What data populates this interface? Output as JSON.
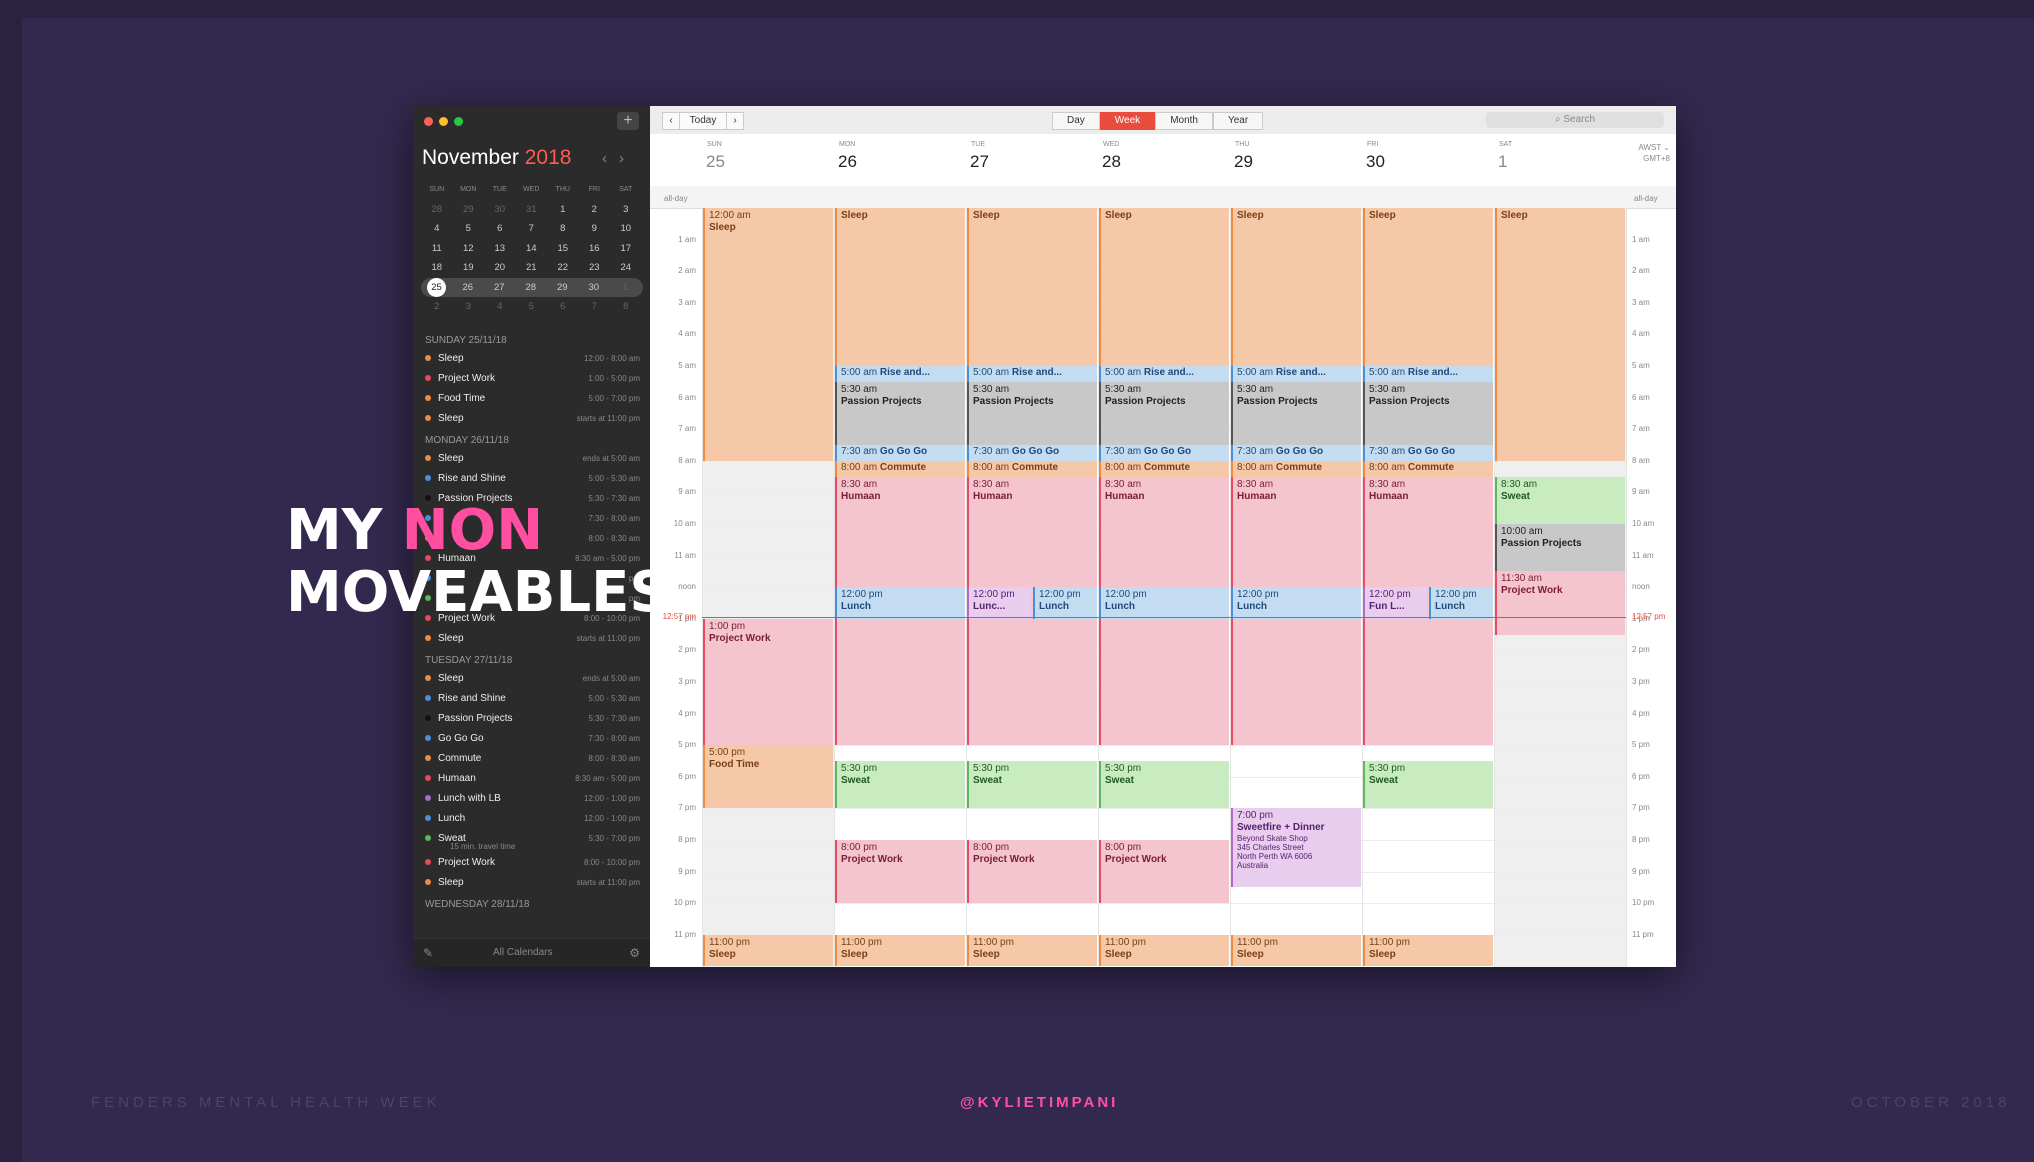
{
  "overlay": {
    "line1a": "MY ",
    "line1b": "NON",
    "line2": "MOVEABLES"
  },
  "footer": {
    "left": "FENDERS MENTAL HEALTH WEEK",
    "center": "@KYLIETIMPANI",
    "right": "OCTOBER 2018"
  },
  "colors": {
    "background": "#33294f",
    "accent_pink": "#ff4fa0",
    "calendar_red": "#e74c3c"
  },
  "sidebar": {
    "month": "November",
    "year": "2018",
    "weekdays": [
      "SUN",
      "MON",
      "TUE",
      "WED",
      "THU",
      "FRI",
      "SAT"
    ],
    "weeks": [
      [
        "28",
        "29",
        "30",
        "31",
        "1",
        "2",
        "3"
      ],
      [
        "4",
        "5",
        "6",
        "7",
        "8",
        "9",
        "10"
      ],
      [
        "11",
        "12",
        "13",
        "14",
        "15",
        "16",
        "17"
      ],
      [
        "18",
        "19",
        "20",
        "21",
        "22",
        "23",
        "24"
      ],
      [
        "25",
        "26",
        "27",
        "28",
        "29",
        "30",
        "1"
      ],
      [
        "2",
        "3",
        "4",
        "5",
        "6",
        "7",
        "8"
      ]
    ],
    "agenda": [
      {
        "header": "SUNDAY 25/11/18",
        "events": [
          {
            "title": "Sleep",
            "time": "12:00 - 8:00 am",
            "color": "#f08a40"
          },
          {
            "title": "Project Work",
            "time": "1:00 - 5:00 pm",
            "color": "#e84a5f"
          },
          {
            "title": "Food Time",
            "time": "5:00 - 7:00 pm",
            "color": "#f08a40"
          },
          {
            "title": "Sleep",
            "time": "starts at 11:00 pm",
            "color": "#f08a40"
          }
        ]
      },
      {
        "header": "MONDAY 26/11/18",
        "events": [
          {
            "title": "Sleep",
            "time": "ends at 5:00 am",
            "color": "#f08a40"
          },
          {
            "title": "Rise and Shine",
            "time": "5:00 - 5:30 am",
            "color": "#4a90d9"
          },
          {
            "title": "Passion Projects",
            "time": "5:30 - 7:30 am",
            "color": "#111111"
          },
          {
            "title": "",
            "time": "7:30 - 8:00 am",
            "color": "#4a90d9"
          },
          {
            "title": "",
            "time": "8:00 - 8:30 am",
            "color": "#f08a40"
          },
          {
            "title": "Humaan",
            "time": "8:30 am - 5:00 pm",
            "color": "#e84a5f"
          },
          {
            "title": "",
            "time": "pm",
            "color": "#4a90d9"
          },
          {
            "title": "",
            "time": "pm",
            "color": "#5cb85c"
          },
          {
            "title": "Project Work",
            "time": "8:00 - 10:00 pm",
            "color": "#e84a5f"
          },
          {
            "title": "Sleep",
            "time": "starts at 11:00 pm",
            "color": "#f08a40"
          }
        ]
      },
      {
        "header": "TUESDAY 27/11/18",
        "events": [
          {
            "title": "Sleep",
            "time": "ends at 5:00 am",
            "color": "#f08a40"
          },
          {
            "title": "Rise and Shine",
            "time": "5:00 - 5:30 am",
            "color": "#4a90d9"
          },
          {
            "title": "Passion Projects",
            "time": "5:30 - 7:30 am",
            "color": "#111111"
          },
          {
            "title": "Go Go Go",
            "time": "7:30 - 8:00 am",
            "color": "#4a90d9"
          },
          {
            "title": "Commute",
            "time": "8:00 - 8:30 am",
            "color": "#f08a40"
          },
          {
            "title": "Humaan",
            "time": "8:30 am - 5:00 pm",
            "color": "#e84a5f"
          },
          {
            "title": "Lunch with LB",
            "time": "12:00 - 1:00 pm",
            "color": "#b06ac8"
          },
          {
            "title": "Lunch",
            "time": "12:00 - 1:00 pm",
            "color": "#4a90d9"
          },
          {
            "title": "Sweat",
            "time": "5:30 - 7:00 pm",
            "color": "#5cb85c",
            "note": "15 min. travel time"
          },
          {
            "title": "Project Work",
            "time": "8:00 - 10:00 pm",
            "color": "#e84a5f"
          },
          {
            "title": "Sleep",
            "time": "starts at 11:00 pm",
            "color": "#f08a40"
          }
        ]
      },
      {
        "header": "WEDNESDAY 28/11/18",
        "events": []
      }
    ],
    "footer_label": "All Calendars"
  },
  "toolbar": {
    "today": "Today",
    "views": [
      "Day",
      "Week",
      "Month",
      "Year"
    ],
    "active_view": "Week",
    "search_placeholder": "Search"
  },
  "week": {
    "days": [
      {
        "dow": "SUN",
        "num": "25"
      },
      {
        "dow": "MON",
        "num": "26"
      },
      {
        "dow": "TUE",
        "num": "27"
      },
      {
        "dow": "WED",
        "num": "28"
      },
      {
        "dow": "THU",
        "num": "29"
      },
      {
        "dow": "FRI",
        "num": "30"
      },
      {
        "dow": "SAT",
        "num": "1"
      }
    ],
    "timezone": [
      "AWST",
      "GMT+8"
    ],
    "allday_label": "all-day",
    "hour_labels": [
      "1 am",
      "2 am",
      "3 am",
      "4 am",
      "5 am",
      "6 am",
      "7 am",
      "8 am",
      "9 am",
      "10 am",
      "11 am",
      "noon",
      "1 pm",
      "2 pm",
      "3 pm",
      "4 pm",
      "5 pm",
      "6 pm",
      "7 pm",
      "8 pm",
      "9 pm",
      "10 pm",
      "11 pm"
    ],
    "now_label": "12:57 pm",
    "now_hour": 12.95,
    "events": [
      {
        "day": 0,
        "start": 0,
        "end": 8,
        "time": "12:00 am",
        "title": "Sleep",
        "color": "orange"
      },
      {
        "day": 0,
        "start": 13,
        "end": 17,
        "time": "1:00 pm",
        "title": "Project Work",
        "color": "pink"
      },
      {
        "day": 0,
        "start": 17,
        "end": 19,
        "time": "5:00 pm",
        "title": "Food Time",
        "color": "orange"
      },
      {
        "day": 0,
        "start": 23,
        "end": 24,
        "time": "11:00 pm",
        "title": "Sleep",
        "color": "orange"
      },
      {
        "day": 1,
        "start": 0,
        "end": 5,
        "time": "",
        "title": "Sleep",
        "color": "orange"
      },
      {
        "day": 1,
        "start": 5,
        "end": 5.5,
        "time": "5:00 am",
        "title": "Rise and...",
        "color": "blue",
        "inline": true
      },
      {
        "day": 1,
        "start": 5.5,
        "end": 7.5,
        "time": "5:30 am",
        "title": "Passion Projects",
        "color": "grey"
      },
      {
        "day": 1,
        "start": 7.5,
        "end": 8,
        "time": "7:30 am",
        "title": "Go Go Go",
        "color": "blue",
        "inline": true
      },
      {
        "day": 1,
        "start": 8,
        "end": 8.5,
        "time": "8:00 am",
        "title": "Commute",
        "color": "orange",
        "inline": true
      },
      {
        "day": 1,
        "start": 8.5,
        "end": 17,
        "time": "8:30 am",
        "title": "Humaan",
        "color": "pink"
      },
      {
        "day": 1,
        "start": 12,
        "end": 13,
        "time": "12:00 pm",
        "title": "Lunch",
        "color": "blue"
      },
      {
        "day": 1,
        "start": 17.5,
        "end": 19,
        "time": "5:30 pm",
        "title": "Sweat",
        "color": "green"
      },
      {
        "day": 1,
        "start": 20,
        "end": 22,
        "time": "8:00 pm",
        "title": "Project Work",
        "color": "pink"
      },
      {
        "day": 1,
        "start": 23,
        "end": 24,
        "time": "11:00 pm",
        "title": "Sleep",
        "color": "orange"
      },
      {
        "day": 2,
        "start": 0,
        "end": 5,
        "time": "",
        "title": "Sleep",
        "color": "orange"
      },
      {
        "day": 2,
        "start": 5,
        "end": 5.5,
        "time": "5:00 am",
        "title": "Rise and...",
        "color": "blue",
        "inline": true
      },
      {
        "day": 2,
        "start": 5.5,
        "end": 7.5,
        "time": "5:30 am",
        "title": "Passion Projects",
        "color": "grey"
      },
      {
        "day": 2,
        "start": 7.5,
        "end": 8,
        "time": "7:30 am",
        "title": "Go Go Go",
        "color": "blue",
        "inline": true
      },
      {
        "day": 2,
        "start": 8,
        "end": 8.5,
        "time": "8:00 am",
        "title": "Commute",
        "color": "orange",
        "inline": true
      },
      {
        "day": 2,
        "start": 8.5,
        "end": 17,
        "time": "8:30 am",
        "title": "Humaan",
        "color": "pink"
      },
      {
        "day": 2,
        "start": 12,
        "end": 13,
        "time": "12:00 pm",
        "title": "Lunc...",
        "color": "purple",
        "half": 0
      },
      {
        "day": 2,
        "start": 12,
        "end": 13,
        "time": "12:00 pm",
        "title": "Lunch",
        "color": "blue",
        "half": 1
      },
      {
        "day": 2,
        "start": 17.5,
        "end": 19,
        "time": "5:30 pm",
        "title": "Sweat",
        "color": "green"
      },
      {
        "day": 2,
        "start": 20,
        "end": 22,
        "time": "8:00 pm",
        "title": "Project Work",
        "color": "pink"
      },
      {
        "day": 2,
        "start": 23,
        "end": 24,
        "time": "11:00 pm",
        "title": "Sleep",
        "color": "orange"
      },
      {
        "day": 3,
        "start": 0,
        "end": 5,
        "time": "",
        "title": "Sleep",
        "color": "orange"
      },
      {
        "day": 3,
        "start": 5,
        "end": 5.5,
        "time": "5:00 am",
        "title": "Rise and...",
        "color": "blue",
        "inline": true
      },
      {
        "day": 3,
        "start": 5.5,
        "end": 7.5,
        "time": "5:30 am",
        "title": "Passion Projects",
        "color": "grey"
      },
      {
        "day": 3,
        "start": 7.5,
        "end": 8,
        "time": "7:30 am",
        "title": "Go Go Go",
        "color": "blue",
        "inline": true
      },
      {
        "day": 3,
        "start": 8,
        "end": 8.5,
        "time": "8:00 am",
        "title": "Commute",
        "color": "orange",
        "inline": true
      },
      {
        "day": 3,
        "start": 8.5,
        "end": 17,
        "time": "8:30 am",
        "title": "Humaan",
        "color": "pink"
      },
      {
        "day": 3,
        "start": 12,
        "end": 13,
        "time": "12:00 pm",
        "title": "Lunch",
        "color": "blue"
      },
      {
        "day": 3,
        "start": 17.5,
        "end": 19,
        "time": "5:30 pm",
        "title": "Sweat",
        "color": "green"
      },
      {
        "day": 3,
        "start": 20,
        "end": 22,
        "time": "8:00 pm",
        "title": "Project Work",
        "color": "pink"
      },
      {
        "day": 3,
        "start": 23,
        "end": 24,
        "time": "11:00 pm",
        "title": "Sleep",
        "color": "orange"
      },
      {
        "day": 4,
        "start": 0,
        "end": 5,
        "time": "",
        "title": "Sleep",
        "color": "orange"
      },
      {
        "day": 4,
        "start": 5,
        "end": 5.5,
        "time": "5:00 am",
        "title": "Rise and...",
        "color": "blue",
        "inline": true
      },
      {
        "day": 4,
        "start": 5.5,
        "end": 7.5,
        "time": "5:30 am",
        "title": "Passion Projects",
        "color": "grey"
      },
      {
        "day": 4,
        "start": 7.5,
        "end": 8,
        "time": "7:30 am",
        "title": "Go Go Go",
        "color": "blue",
        "inline": true
      },
      {
        "day": 4,
        "start": 8,
        "end": 8.5,
        "time": "8:00 am",
        "title": "Commute",
        "color": "orange",
        "inline": true
      },
      {
        "day": 4,
        "start": 8.5,
        "end": 17,
        "time": "8:30 am",
        "title": "Humaan",
        "color": "pink"
      },
      {
        "day": 4,
        "start": 12,
        "end": 13,
        "time": "12:00 pm",
        "title": "Lunch",
        "color": "blue"
      },
      {
        "day": 4,
        "start": 19,
        "end": 21.5,
        "time": "7:00 pm",
        "title": "Sweetfire + Dinner",
        "color": "purple",
        "details": [
          "Beyond Skate Shop",
          "345 Charles Street",
          "North Perth WA 6006",
          "Australia"
        ]
      },
      {
        "day": 4,
        "start": 23,
        "end": 24,
        "time": "11:00 pm",
        "title": "Sleep",
        "color": "orange"
      },
      {
        "day": 5,
        "start": 0,
        "end": 5,
        "time": "",
        "title": "Sleep",
        "color": "orange"
      },
      {
        "day": 5,
        "start": 5,
        "end": 5.5,
        "time": "5:00 am",
        "title": "Rise and...",
        "color": "blue",
        "inline": true
      },
      {
        "day": 5,
        "start": 5.5,
        "end": 7.5,
        "time": "5:30 am",
        "title": "Passion Projects",
        "color": "grey"
      },
      {
        "day": 5,
        "start": 7.5,
        "end": 8,
        "time": "7:30 am",
        "title": "Go Go Go",
        "color": "blue",
        "inline": true
      },
      {
        "day": 5,
        "start": 8,
        "end": 8.5,
        "time": "8:00 am",
        "title": "Commute",
        "color": "orange",
        "inline": true
      },
      {
        "day": 5,
        "start": 8.5,
        "end": 17,
        "time": "8:30 am",
        "title": "Humaan",
        "color": "pink"
      },
      {
        "day": 5,
        "start": 12,
        "end": 13,
        "time": "12:00 pm",
        "title": "Fun L...",
        "color": "purple",
        "half": 0
      },
      {
        "day": 5,
        "start": 12,
        "end": 13,
        "time": "12:00 pm",
        "title": "Lunch",
        "color": "blue",
        "half": 1
      },
      {
        "day": 5,
        "start": 17.5,
        "end": 19,
        "time": "5:30 pm",
        "title": "Sweat",
        "color": "green"
      },
      {
        "day": 5,
        "start": 23,
        "end": 24,
        "time": "11:00 pm",
        "title": "Sleep",
        "color": "orange"
      },
      {
        "day": 6,
        "start": 0,
        "end": 8,
        "time": "",
        "title": "Sleep",
        "color": "orange"
      },
      {
        "day": 6,
        "start": 8.5,
        "end": 10,
        "time": "8:30 am",
        "title": "Sweat",
        "color": "green"
      },
      {
        "day": 6,
        "start": 10,
        "end": 11.5,
        "time": "10:00 am",
        "title": "Passion Projects",
        "color": "grey"
      },
      {
        "day": 6,
        "start": 11.5,
        "end": 13.5,
        "time": "11:30 am",
        "title": "Project Work",
        "color": "pink"
      }
    ]
  }
}
